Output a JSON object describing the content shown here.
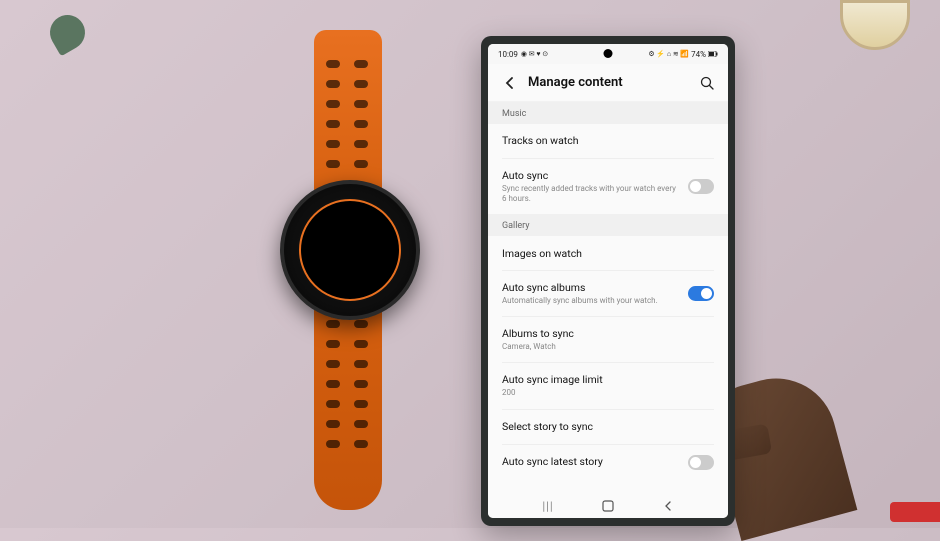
{
  "status_bar": {
    "time": "10:09",
    "left_icons": "◉ ✉ ♥ ⊙",
    "right_icons": "⚙ ⚡ ⌂ ≋ 📶",
    "battery": "74%"
  },
  "header": {
    "title": "Manage content"
  },
  "sections": {
    "music": {
      "label": "Music",
      "tracks": {
        "title": "Tracks on watch"
      },
      "autosync": {
        "title": "Auto sync",
        "sub": "Sync recently added tracks with your watch every 6 hours.",
        "enabled": false
      }
    },
    "gallery": {
      "label": "Gallery",
      "images": {
        "title": "Images on watch"
      },
      "autosync_albums": {
        "title": "Auto sync albums",
        "sub": "Automatically sync albums with your watch.",
        "enabled": true
      },
      "albums_to_sync": {
        "title": "Albums to sync",
        "sub": "Camera, Watch"
      },
      "image_limit": {
        "title": "Auto sync image limit",
        "sub": "200"
      },
      "select_story": {
        "title": "Select story to sync"
      },
      "autosync_story": {
        "title": "Auto sync latest story",
        "enabled": false
      }
    }
  },
  "nav": {
    "recent": "|||",
    "home": "○",
    "back": "<"
  }
}
